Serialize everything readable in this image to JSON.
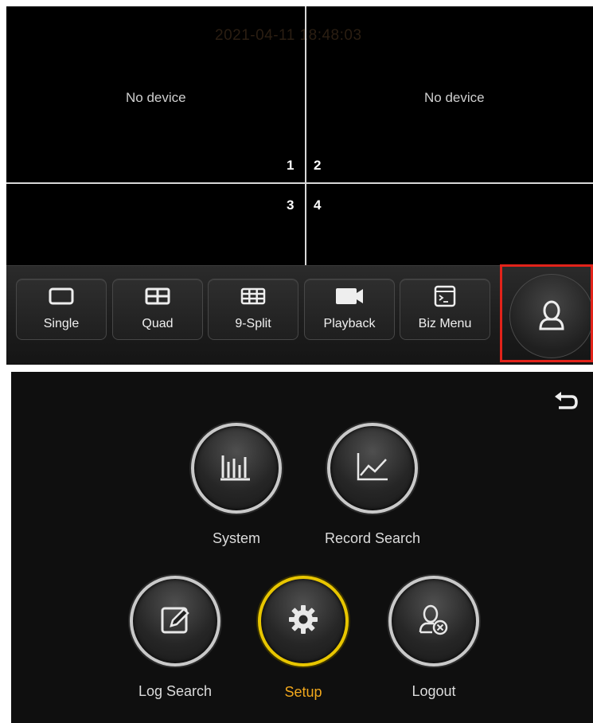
{
  "live_view": {
    "timestamp": "2021-04-11 18:48:03",
    "channels": [
      {
        "status": "No device",
        "number": "1"
      },
      {
        "status": "No device",
        "number": "2"
      },
      {
        "status": "",
        "number": "3"
      },
      {
        "status": "",
        "number": "4"
      }
    ]
  },
  "toolbar": {
    "buttons": [
      {
        "label": "Single",
        "icon": "single-view-icon"
      },
      {
        "label": "Quad",
        "icon": "quad-view-icon"
      },
      {
        "label": "9-Split",
        "icon": "nine-split-icon"
      },
      {
        "label": "Playback",
        "icon": "camera-icon"
      },
      {
        "label": "Biz Menu",
        "icon": "terminal-icon"
      }
    ],
    "user_button_icon": "user-icon",
    "highlight_color": "#e2231a"
  },
  "main_menu": {
    "back_icon": "back-arrow-icon",
    "items": [
      {
        "label": "System",
        "icon": "bar-chart-icon",
        "active": false
      },
      {
        "label": "Record Search",
        "icon": "line-chart-icon",
        "active": false
      },
      {
        "label": "Log Search",
        "icon": "edit-icon",
        "active": false
      },
      {
        "label": "Setup",
        "icon": "gear-icon",
        "active": true
      },
      {
        "label": "Logout",
        "icon": "logout-user-icon",
        "active": false
      }
    ],
    "active_color": "#e8c600",
    "active_label_color": "#f2a81c"
  }
}
